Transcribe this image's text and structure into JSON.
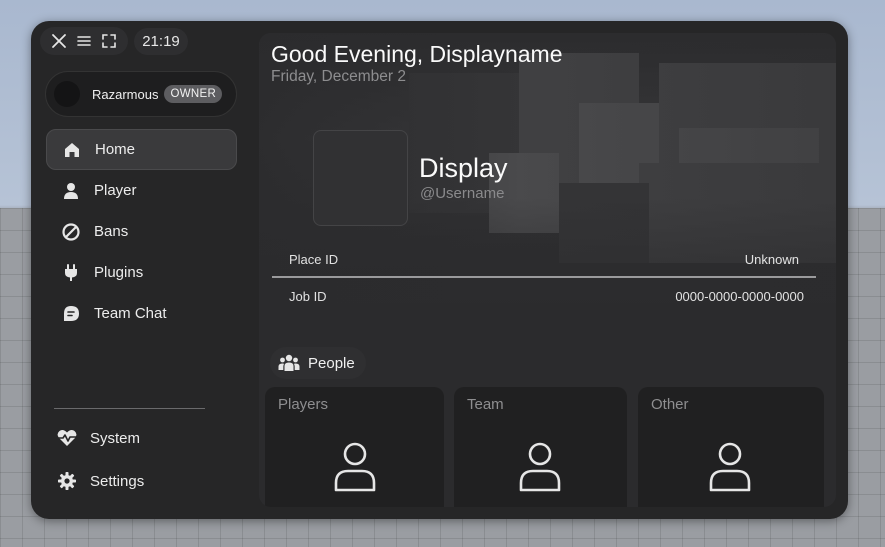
{
  "window": {
    "controls": [
      "close-icon",
      "menu-icon",
      "fullscreen-icon"
    ],
    "clock": "21:19"
  },
  "user": {
    "name": "Razarmous",
    "role": "OWNER"
  },
  "nav": {
    "items": [
      {
        "label": "Home",
        "icon": "home-icon",
        "active": true
      },
      {
        "label": "Player",
        "icon": "person-icon"
      },
      {
        "label": "Bans",
        "icon": "ban-icon"
      },
      {
        "label": "Plugins",
        "icon": "plug-icon"
      },
      {
        "label": "Team Chat",
        "icon": "chat-icon"
      }
    ],
    "bottom": [
      {
        "label": "System",
        "icon": "heartbeat-icon"
      },
      {
        "label": "Settings",
        "icon": "gear-icon"
      }
    ]
  },
  "main": {
    "greeting": "Good Evening, Displayname",
    "date": "Friday, December 2",
    "profile": {
      "display": "Display",
      "username": "@Username"
    },
    "info": [
      {
        "label": "Place ID",
        "value": "Unknown"
      },
      {
        "label": "Job ID",
        "value": "0000-0000-0000-0000"
      }
    ],
    "people": {
      "label": "People",
      "cards": [
        "Players",
        "Team",
        "Other"
      ]
    }
  },
  "colors": {
    "window_bg": "#262627",
    "active_nav": "#3a3a3c",
    "badge": "#5d5d60"
  }
}
